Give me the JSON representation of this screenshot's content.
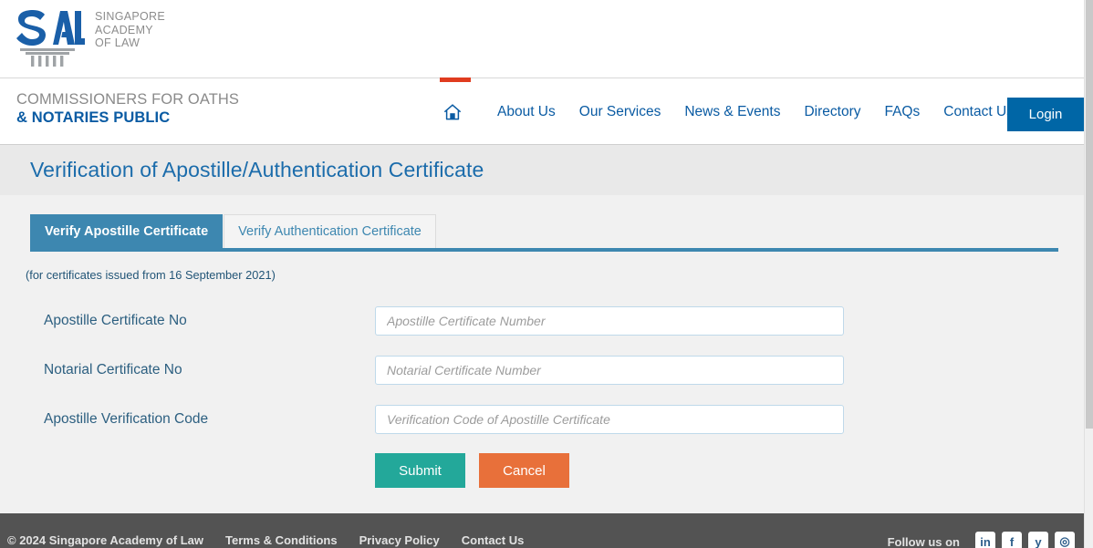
{
  "brand": {
    "logo_text": "SAL",
    "logo_words": "SINGAPORE\nACADEMY\nOF LAW",
    "site_title_line1": "COMMISSIONERS FOR OATHS",
    "site_title_line2": "& NOTARIES PUBLIC",
    "logo_blue": "#1a5fa8",
    "accent_red": "#e03c1f"
  },
  "nav": {
    "home_icon": "home-icon",
    "items": [
      {
        "label": "About Us"
      },
      {
        "label": "Our Services"
      },
      {
        "label": "News & Events"
      },
      {
        "label": "Directory"
      },
      {
        "label": "FAQs"
      },
      {
        "label": "Contact Us"
      }
    ],
    "login_label": "Login",
    "login_color": "#0066a6",
    "link_color": "#0a5ba3"
  },
  "page": {
    "title": "Verification of Apostille/Authentication Certificate",
    "title_color": "#1b6cab",
    "title_band_bg": "#e9e9e9"
  },
  "tabs": {
    "active_index": 0,
    "active_color": "#3d87b0",
    "items": [
      {
        "label": "Verify Apostille Certificate",
        "active": true
      },
      {
        "label": "Verify Authentication Certificate",
        "active": false
      }
    ]
  },
  "form": {
    "note": "(for certificates issued from 16 September 2021)",
    "fields": [
      {
        "label": "Apostille Certificate No",
        "placeholder": "Apostille Certificate Number",
        "value": ""
      },
      {
        "label": "Notarial Certificate No",
        "placeholder": "Notarial Certificate Number",
        "value": ""
      },
      {
        "label": "Apostille Verification Code",
        "placeholder": "Verification Code of Apostille Certificate",
        "value": ""
      }
    ],
    "submit_label": "Submit",
    "cancel_label": "Cancel",
    "submit_color": "#23a89a",
    "cancel_color": "#e8703a"
  },
  "footer": {
    "copyright": "© 2024 Singapore Academy of Law",
    "links": [
      {
        "label": "Terms & Conditions"
      },
      {
        "label": "Privacy Policy"
      },
      {
        "label": "Contact Us"
      }
    ],
    "follow_text": "Follow us on",
    "socials": [
      {
        "name": "linkedin-icon",
        "glyph": "in"
      },
      {
        "name": "facebook-icon",
        "glyph": "f"
      },
      {
        "name": "twitter-icon",
        "glyph": "y"
      },
      {
        "name": "instagram-icon",
        "glyph": "◎"
      }
    ],
    "bg": "#535353"
  }
}
